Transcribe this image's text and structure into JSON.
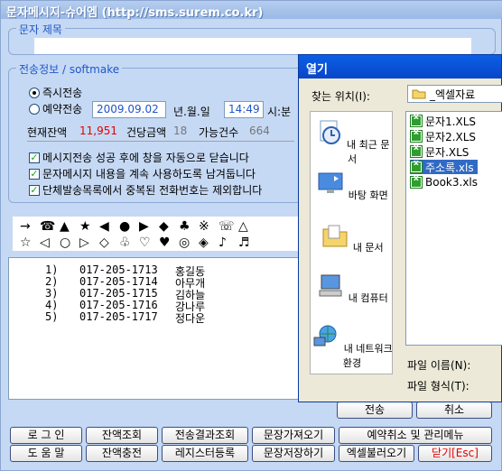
{
  "main": {
    "title": "문자메시지-슈어엠 (http://sms.surem.co.kr)",
    "subject_label": "문자 제목",
    "subject_value": "",
    "send_group_label": "전송정보 / softmake",
    "immediate_label": "즉시전송",
    "reserve_label": "예약전송",
    "date_value": "2009.09.02",
    "date_unit": "년.월.일",
    "time_value": "14:49",
    "time_unit": "시:분",
    "balance_label": "현재잔액",
    "balance_value": "11,951",
    "unit_price_label": "건당금액",
    "unit_price_value": "18",
    "count_label": "가능건수",
    "count_value": "664",
    "check1": "메시지전송 성공 후에 창을 자동으로 닫습니다",
    "check2": "문자메시지 내용을 계속 사용하도록 남겨둡니다",
    "check3": "단체발송목록에서 중복된 전화번호는 제외합니다",
    "symbols_row1": [
      "→",
      "☎",
      "▲",
      "★",
      "◀",
      "●",
      "▶",
      "◆",
      "♣",
      "※",
      "☏",
      "△"
    ],
    "symbols_row2": [
      "☆",
      "◁",
      "○",
      "▷",
      "◇",
      "♧",
      "♡",
      "♥",
      "◎",
      "◈",
      "♪",
      "♬"
    ],
    "recipients": [
      {
        "num": "1)",
        "phone": "017-205-1713",
        "name": "홍길동"
      },
      {
        "num": "2)",
        "phone": "017-205-1714",
        "name": "아무개"
      },
      {
        "num": "3)",
        "phone": "017-205-1715",
        "name": "김하늘"
      },
      {
        "num": "4)",
        "phone": "017-205-1716",
        "name": "강나루"
      },
      {
        "num": "5)",
        "phone": "017-205-1717",
        "name": "정다운"
      }
    ],
    "send_button": "전송",
    "cancel_button": "취소",
    "buttons_row1": [
      "로 그 인",
      "잔액조회",
      "전송결과조회",
      "문장가져오기",
      "예약취소 및 관리메뉴"
    ],
    "buttons_row2": [
      "도 움 말",
      "잔액충전",
      "레지스터등록",
      "문장저장하기",
      "엑셀불러오기",
      "닫기[Esc]"
    ]
  },
  "dialog": {
    "title": "열기",
    "location_label": "찾는 위치(I):",
    "location_value": "_엑셀자료",
    "places": [
      "내 최근 문서",
      "바탕 화면",
      "내 문서",
      "내 컴퓨터",
      "내 네트워크 환경"
    ],
    "files": [
      "문자1.XLS",
      "문자2.XLS",
      "문자.XLS",
      "주소록.xls",
      "Book3.xls"
    ],
    "selected_file_index": 3,
    "filename_label": "파일 이름(N):",
    "filetype_label": "파일 형식(T):"
  },
  "colors": {
    "window_bg": "#c6d9f4",
    "accent_blue": "#1e56c8",
    "balance_red": "#e00000",
    "dialog_title": "#0a5fe6",
    "selection": "#316ac5"
  }
}
